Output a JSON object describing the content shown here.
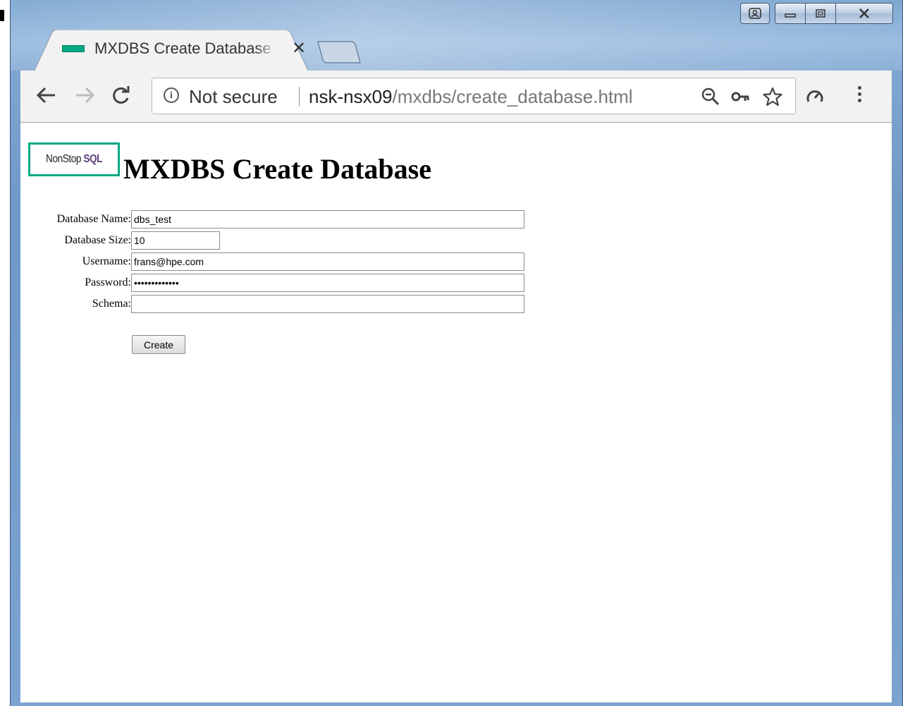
{
  "browser": {
    "tab_title": "MXDBS Create Database",
    "tab_close": "✕",
    "security_label": "Not secure",
    "url_host": "nsk-nsx09",
    "url_path": "/mxdbs/create_database.html",
    "favicon_color": "#01a982"
  },
  "page": {
    "logo_text_plain": "NonStop",
    "logo_text_bold": "SQL",
    "heading": "MXDBS Create Database",
    "form": {
      "database_name_label": "Database Name:",
      "database_name_value": "dbs_test",
      "database_size_label": "Database Size:",
      "database_size_value": "10",
      "username_label": "Username:",
      "username_value": "frans@hpe.com",
      "password_label": "Password:",
      "password_value": "•••••••••••••",
      "schema_label": "Schema:",
      "schema_value": "",
      "create_button": "Create"
    }
  },
  "colors": {
    "logo_border": "#01a982",
    "logo_accent": "#5a3d7a"
  }
}
